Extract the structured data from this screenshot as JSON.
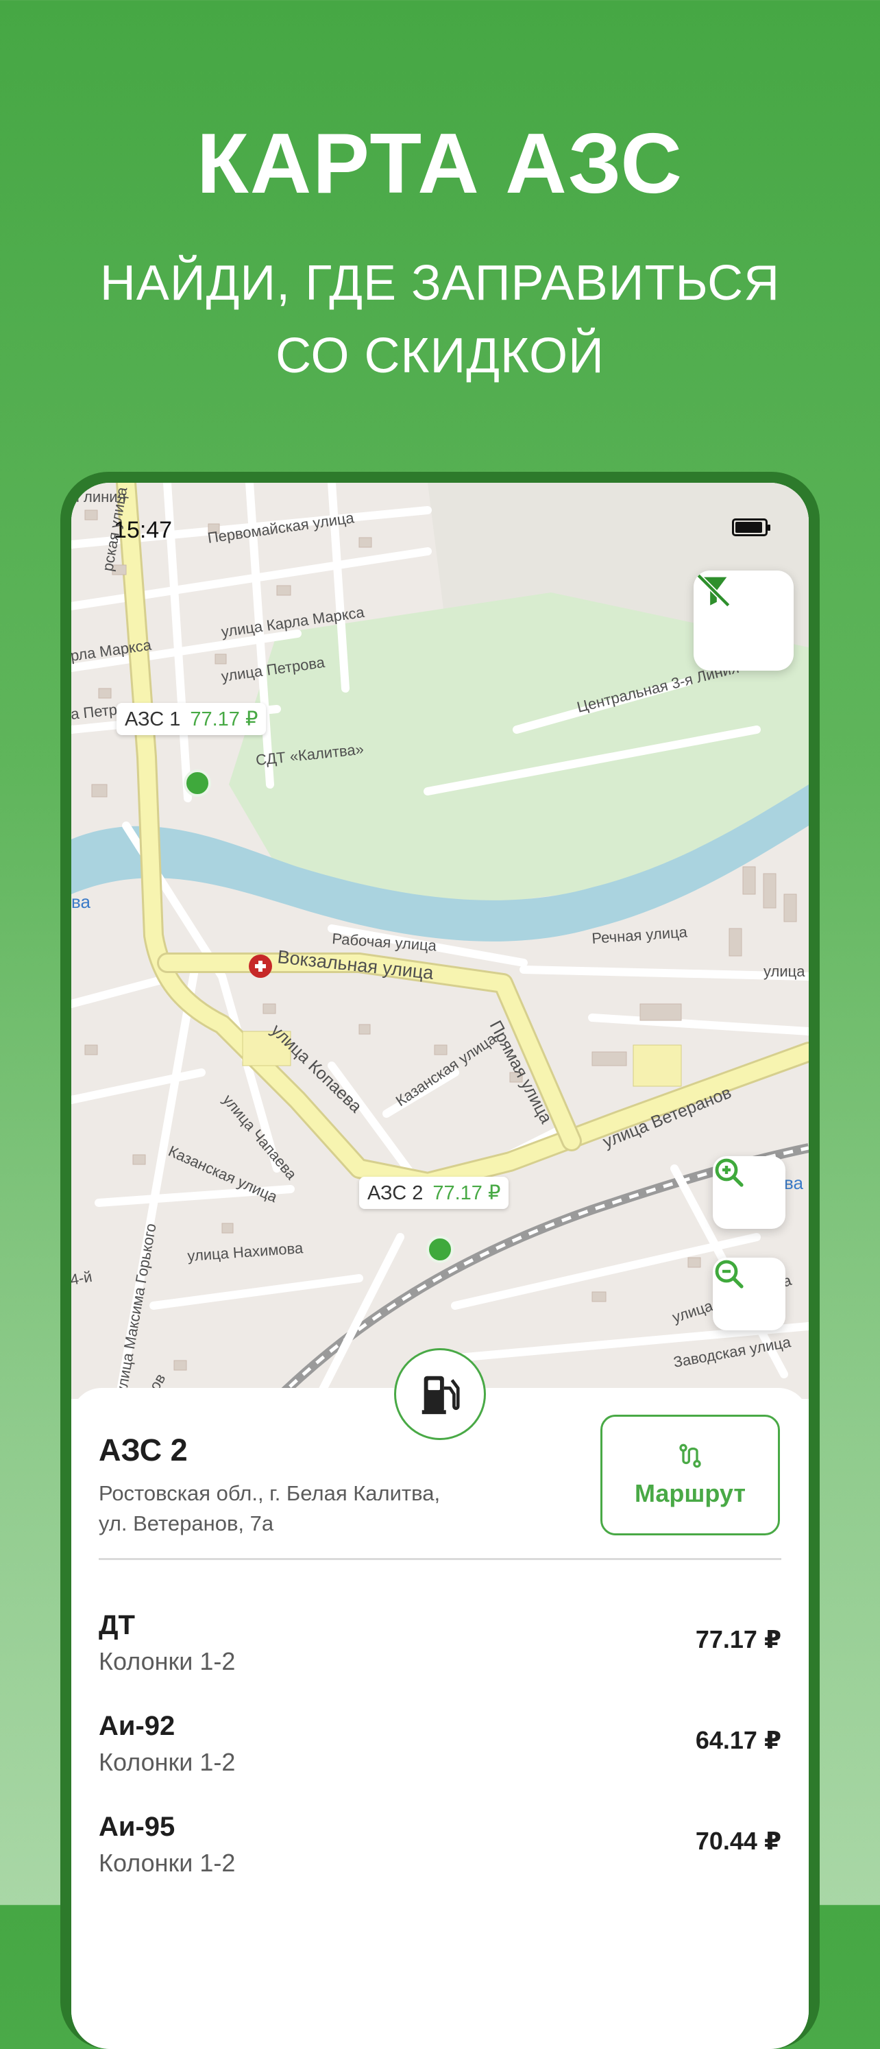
{
  "promo": {
    "title": "КАРТА АЗС",
    "subtitle_line1": "НАЙДИ, ГДЕ ЗАПРАВИТЬСЯ",
    "subtitle_line2": "СО СКИДКОЙ"
  },
  "status_bar": {
    "time": "15:47",
    "battery_level": 0.85
  },
  "map": {
    "street_labels": [
      "Первомайская улица",
      "улица Карла Маркса",
      "рла Маркса",
      "улица Петрова",
      "а Петрова",
      "СДТ «Калитва»",
      "Центральная 3-я Линия",
      "Рабочая улица",
      "Вокзальная улица",
      "Речная улица",
      "улица",
      "улица Копаева",
      "Прямая улица",
      "Казанская улица",
      "улица Ветеранов",
      "улица Чапаева",
      "Казанская улица",
      "улица Нахимова",
      "улица Максима Горького",
      "улица Вахрушева",
      "Заводская улица",
      "рская улица",
      "ва",
      "ва",
      "4-й",
      "нов",
      "я линия"
    ],
    "stations": [
      {
        "name": "АЗС 1",
        "price": "77.17 ₽"
      },
      {
        "name": "АЗС 2",
        "price": "77.17 ₽"
      }
    ],
    "icons": {
      "filter_off": "filter-off-icon",
      "zoom_in": "zoom-in-icon",
      "zoom_out": "zoom-out-icon",
      "fuel": "fuel-pump-icon",
      "hospital": "medical-cross-icon"
    }
  },
  "station_card": {
    "name": "АЗС 2",
    "address_line1": "Ростовская обл., г. Белая Калитва,",
    "address_line2": "ул. Ветеранов, 7а",
    "route_button": "Маршрут",
    "route_icon": "route-icon",
    "fuels": [
      {
        "name": "ДТ",
        "columns": "Колонки 1-2",
        "price": "77.17 ₽"
      },
      {
        "name": "Аи-92",
        "columns": "Колонки 1-2",
        "price": "64.17 ₽"
      },
      {
        "name": "Аи-95",
        "columns": "Колонки 1-2",
        "price": "70.44 ₽"
      }
    ]
  },
  "colors": {
    "accent": "#49a946",
    "background_top": "#46a744",
    "background_bottom": "#a9d7a6",
    "phone_frame": "#2d7a2b"
  }
}
